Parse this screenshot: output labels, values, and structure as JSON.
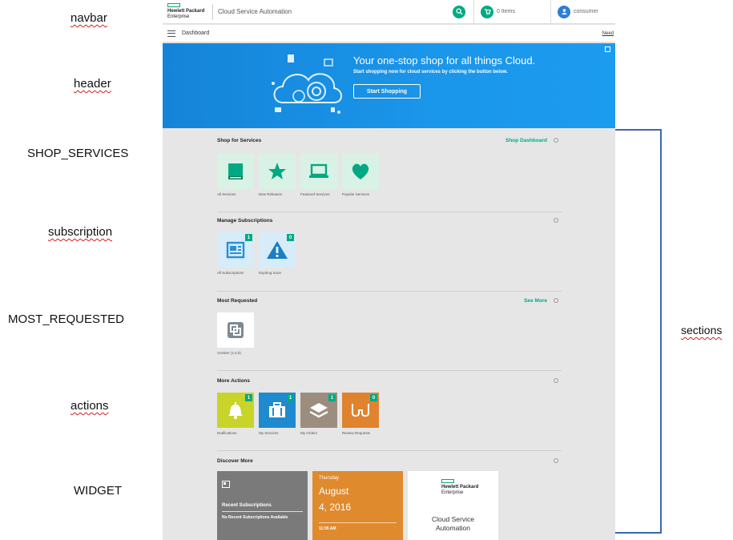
{
  "annotations": {
    "navbar": "navbar",
    "header": "header",
    "shop_services": "SHOP_SERVICES",
    "subscription": "subscription",
    "most_requested": "MOST_REQUESTED",
    "actions": "actions",
    "widget": "WIDGET",
    "sections": "sections"
  },
  "navbar": {
    "logo_line1": "Hewlett Packard",
    "logo_line2": "Enterprise",
    "app_title": "Cloud Service Automation",
    "cart_label": "0 Items",
    "user_label": "consumer"
  },
  "subbar": {
    "breadcrumb": "Dashboard",
    "help_link": "Need"
  },
  "hero": {
    "title": "Your one-stop shop for all things Cloud.",
    "subtitle": "Start shopping now for cloud services by clicking the button below.",
    "button": "Start Shopping"
  },
  "sections": {
    "shop": {
      "title": "Shop for Services",
      "link": "Shop Dashboard",
      "tiles": [
        {
          "label": "All Services",
          "icon": "book-icon",
          "color": "#01a982"
        },
        {
          "label": "New Releases",
          "icon": "star-icon",
          "color": "#01a982"
        },
        {
          "label": "Featured Services",
          "icon": "laptop-icon",
          "color": "#01a982"
        },
        {
          "label": "Popular Services",
          "icon": "heart-icon",
          "color": "#01a982"
        }
      ]
    },
    "subscriptions": {
      "title": "Manage Subscriptions",
      "tiles": [
        {
          "label": "All Subscriptions",
          "badge": "1",
          "icon": "newspaper-icon",
          "color": "#2a8fd4"
        },
        {
          "label": "Expiring Soon",
          "badge": "0",
          "icon": "warning-icon",
          "color": "#1a7fc4"
        }
      ]
    },
    "most_requested": {
      "title": "Most Requested",
      "link": "See More",
      "tiles": [
        {
          "label": "Vcenter (1.0.0)",
          "icon": "vcenter-icon"
        }
      ]
    },
    "actions": {
      "title": "More Actions",
      "tiles": [
        {
          "label": "Notifications",
          "badge": "1",
          "icon": "bell-icon",
          "bg": "#c9d42a"
        },
        {
          "label": "My Services",
          "badge": "1",
          "icon": "briefcase-icon",
          "bg": "#1f8ad0"
        },
        {
          "label": "My Orders",
          "badge": "1",
          "icon": "layers-icon",
          "bg": "#9c8e7e"
        },
        {
          "label": "Review Requests",
          "badge": "0",
          "icon": "glasses-icon",
          "bg": "#e0832e"
        }
      ]
    },
    "discover": {
      "title": "Discover More",
      "recent": {
        "title": "Recent Subscriptions",
        "empty": "No Recent Subscriptions Available"
      },
      "calendar": {
        "day": "Thursday",
        "month": "August",
        "date": "4, 2016",
        "time": "11:05 AM"
      },
      "product": {
        "logo_line1": "Hewlett Packard",
        "logo_line2": "Enterprise",
        "name": "Cloud Service Automation"
      }
    }
  },
  "colors": {
    "accent": "#01a982",
    "hero_blue": "#1a96ea",
    "bracket": "#3a66b5"
  }
}
